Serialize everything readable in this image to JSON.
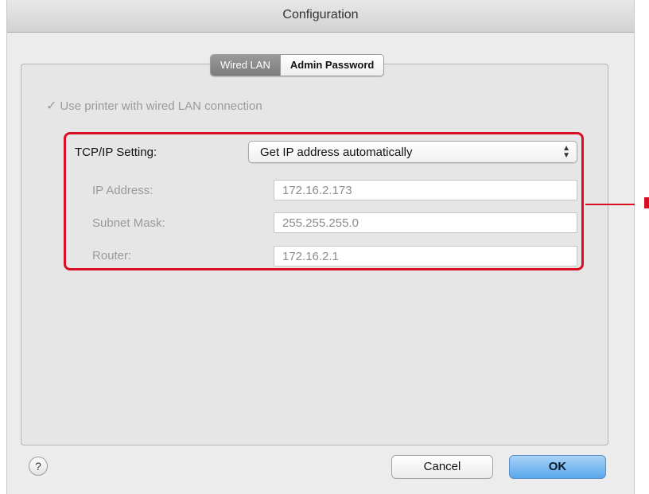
{
  "window": {
    "title": "Configuration"
  },
  "tabs": [
    {
      "label": "Wired LAN",
      "active": true
    },
    {
      "label": "Admin Password",
      "active": false
    }
  ],
  "wired_lan": {
    "checkbox_label": "Use printer with wired LAN connection",
    "checkbox_checked": true,
    "tcpip_label": "TCP/IP Setting:",
    "tcpip_value": "Get IP address automatically",
    "ip_label": "IP Address:",
    "ip_value": "172.16.2.173",
    "subnet_label": "Subnet Mask:",
    "subnet_value": "255.255.255.0",
    "router_label": "Router:",
    "router_value": "172.16.2.1"
  },
  "footer": {
    "help_label": "?",
    "cancel_label": "Cancel",
    "ok_label": "OK"
  },
  "colors": {
    "highlight": "#d80f22",
    "ok_button": "#5aa8ec"
  },
  "icons": {
    "check": "checkmark-icon",
    "arrows": "updown-arrows-icon"
  }
}
